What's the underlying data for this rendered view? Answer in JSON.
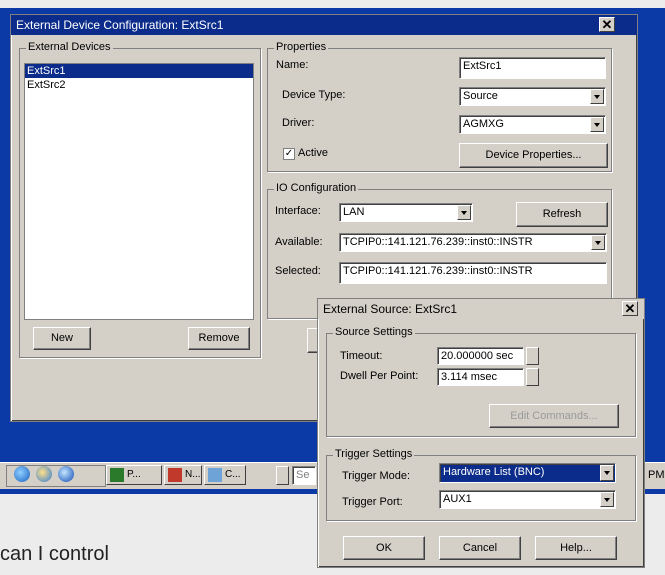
{
  "main_window": {
    "title": "External Device Configuration: ExtSrc1",
    "close_glyph": "✕",
    "devices_group": "External Devices",
    "devices": [
      "ExtSrc1",
      "ExtSrc2"
    ],
    "new_button": "New",
    "remove_button": "Remove",
    "properties_group": "Properties",
    "name_label": "Name:",
    "name_value": "ExtSrc1",
    "device_type_label": "Device Type:",
    "device_type_value": "Source",
    "driver_label": "Driver:",
    "driver_value": "AGMXG",
    "active_label": "Active",
    "device_properties_button": "Device Properties...",
    "io_group": "IO Configuration",
    "interface_label": "Interface:",
    "interface_value": "LAN",
    "refresh_button": "Refresh",
    "available_label": "Available:",
    "available_value": "TCPIP0::141.121.76.239::inst0::INSTR",
    "selected_label": "Selected:",
    "selected_value": "TCPIP0::141.121.76.239::inst0::INSTR"
  },
  "taskbar": {
    "items": [
      "P...",
      "N...",
      "C..."
    ],
    "time_fragment": "PM",
    "search_fragment": "Se"
  },
  "source_dialog": {
    "title": "External Source: ExtSrc1",
    "close_glyph": "✕",
    "source_group": "Source Settings",
    "timeout_label": "Timeout:",
    "timeout_value": "20.000000 sec",
    "dwell_label": "Dwell Per Point:",
    "dwell_value": "3.114 msec",
    "edit_commands_button": "Edit Commands...",
    "trigger_group": "Trigger Settings",
    "trigger_mode_label": "Trigger Mode:",
    "trigger_mode_value": "Hardware List (BNC)",
    "trigger_port_label": "Trigger Port:",
    "trigger_port_value": "AUX1",
    "ok_button": "OK",
    "cancel_button": "Cancel",
    "help_button": "Help..."
  },
  "caption": "can I control",
  "colors": {
    "titlebar": "#0b2c8a",
    "desktop": "#0b3aa6",
    "window_face": "#d4d0c8",
    "page_background": "#ececec"
  }
}
